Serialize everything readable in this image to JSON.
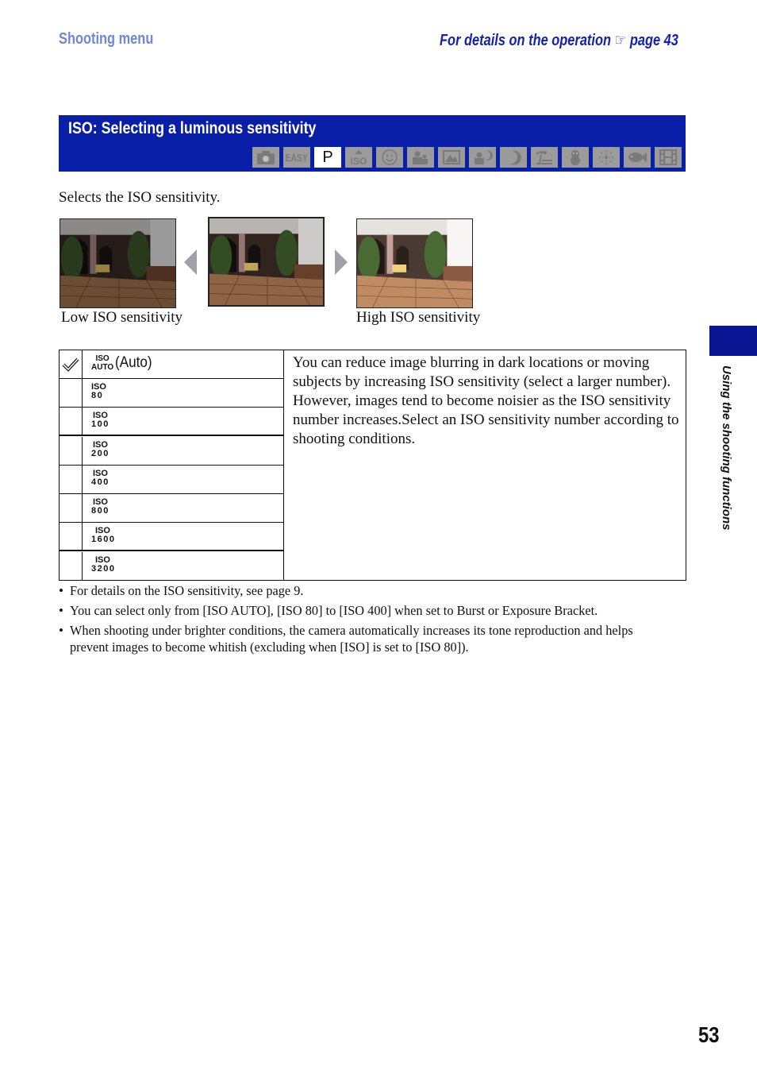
{
  "header": {
    "section": "Shooting menu",
    "details_text": "For details on the operation",
    "details_icon": "pointing-hand-icon",
    "details_glyph": "☞",
    "details_page": "page 43"
  },
  "title_bar": {
    "title": "ISO: Selecting a luminous sensitivity",
    "modes": [
      {
        "name": "auto-camera",
        "icon": "camera-icon",
        "label": "",
        "active": false
      },
      {
        "name": "easy",
        "icon": "easy-icon",
        "label": "EASY",
        "active": false
      },
      {
        "name": "program",
        "icon": "program-icon",
        "label": "P",
        "active": true
      },
      {
        "name": "high-sensitivity",
        "icon": "iso-high-icon",
        "label": "ISO",
        "active": false
      },
      {
        "name": "smile",
        "icon": "smile-icon",
        "label": "",
        "active": false
      },
      {
        "name": "soft-snap",
        "icon": "soft-snap-icon",
        "label": "",
        "active": false
      },
      {
        "name": "landscape",
        "icon": "landscape-icon",
        "label": "",
        "active": false
      },
      {
        "name": "twilight-portrait",
        "icon": "twilight-portrait-icon",
        "label": "",
        "active": false
      },
      {
        "name": "twilight",
        "icon": "moon-icon",
        "label": "",
        "active": false
      },
      {
        "name": "beach",
        "icon": "beach-icon",
        "label": "",
        "active": false
      },
      {
        "name": "snow",
        "icon": "snowman-icon",
        "label": "",
        "active": false
      },
      {
        "name": "fireworks",
        "icon": "fireworks-icon",
        "label": "",
        "active": false
      },
      {
        "name": "underwater",
        "icon": "fish-icon",
        "label": "",
        "active": false
      },
      {
        "name": "movie",
        "icon": "film-icon",
        "label": "",
        "active": false
      }
    ],
    "colors": {
      "bar": "#0a1fa8",
      "mode_inactive": "#9b9b9b",
      "mode_active": "#ffffff"
    }
  },
  "intro": "Selects the ISO sensitivity.",
  "illustration": {
    "caption_low": "Low ISO sensitivity",
    "caption_high": "High ISO sensitivity"
  },
  "table": {
    "rows": [
      {
        "iso_top": "ISO",
        "iso_value": "AUTO",
        "label": "(Auto)",
        "default": true
      },
      {
        "iso_top": "ISO",
        "iso_value": "80",
        "label": "",
        "default": false
      },
      {
        "iso_top": "ISO",
        "iso_value": "100",
        "label": "",
        "default": false
      },
      {
        "iso_top": "ISO",
        "iso_value": "200",
        "label": "",
        "default": false
      },
      {
        "iso_top": "ISO",
        "iso_value": "400",
        "label": "",
        "default": false
      },
      {
        "iso_top": "ISO",
        "iso_value": "800",
        "label": "",
        "default": false
      },
      {
        "iso_top": "ISO",
        "iso_value": "1600",
        "label": "",
        "default": false
      },
      {
        "iso_top": "ISO",
        "iso_value": "3200",
        "label": "",
        "default": false
      }
    ],
    "description": "You can reduce image blurring in dark locations or moving subjects by increasing ISO sensitivity (select a larger number). However, images tend to become noisier as the ISO sensitivity number increases.Select an ISO sensitivity number according to shooting conditions."
  },
  "notes": [
    "For details on the ISO sensitivity, see page 9.",
    "You can select only from [ISO AUTO], [ISO 80] to [ISO 400] when set to Burst or Exposure Bracket.",
    "When shooting under brighter conditions, the camera automatically increases its tone reproduction and helps prevent images to become whitish (excluding when [ISO] is set to [ISO 80])."
  ],
  "side_tab": {
    "label": "Using the shooting functions",
    "color": "#0a1594"
  },
  "page_number": "53"
}
